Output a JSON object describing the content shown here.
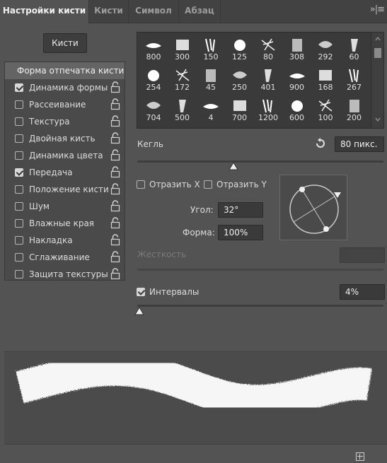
{
  "tabs": [
    {
      "label": "Настройки кисти",
      "active": true
    },
    {
      "label": "Кисти",
      "active": false
    },
    {
      "label": "Символ",
      "active": false
    },
    {
      "label": "Абзац",
      "active": false
    }
  ],
  "tab_menu_glyph": "»|≡",
  "brushes_button": "Кисти",
  "left_list": {
    "header": "Форма отпечатка кисти",
    "items": [
      {
        "label": "Динамика формы",
        "checked": true,
        "lock": true
      },
      {
        "label": "Рассеивание",
        "checked": false,
        "lock": true
      },
      {
        "label": "Текстура",
        "checked": false,
        "lock": true
      },
      {
        "label": "Двойная кисть",
        "checked": false,
        "lock": true
      },
      {
        "label": "Динамика цвета",
        "checked": false,
        "lock": true
      },
      {
        "label": "Передача",
        "checked": true,
        "lock": true
      },
      {
        "label": "Положение кисти",
        "checked": false,
        "lock": true
      },
      {
        "label": "Шум",
        "checked": false,
        "lock": true
      },
      {
        "label": "Влажные края",
        "checked": false,
        "lock": true
      },
      {
        "label": "Накладка",
        "checked": false,
        "lock": true
      },
      {
        "label": "Сглаживание",
        "checked": false,
        "lock": true
      },
      {
        "label": "Защита текстуры",
        "checked": false,
        "lock": true
      }
    ]
  },
  "brush_grid": {
    "rows": [
      [
        "800",
        "300",
        "150",
        "125",
        "80",
        "308",
        "292",
        "60"
      ],
      [
        "254",
        "172",
        "45",
        "250",
        "401",
        "900",
        "168",
        "267"
      ],
      [
        "704",
        "500",
        "4",
        "700",
        "1200",
        "600",
        "100",
        "200"
      ],
      [
        "",
        "",
        "",
        "",
        "",
        "",
        "",
        ""
      ]
    ]
  },
  "size": {
    "label": "Кегль",
    "value": "80 пикс.",
    "fraction": 0.39
  },
  "flip_x": {
    "label": "Отразить X",
    "checked": false
  },
  "flip_y": {
    "label": "Отразить Y",
    "checked": false
  },
  "angle": {
    "label": "Угол:",
    "value": "32°"
  },
  "roundness": {
    "label": "Форма:",
    "value": "100%"
  },
  "hardness": {
    "label": "Жесткость",
    "value": "",
    "disabled": true
  },
  "spacing": {
    "label": "Интервалы",
    "checked": true,
    "value": "4%",
    "fraction": 0.01
  },
  "icons": {
    "reset": "reset-icon",
    "lock": "lock-icon",
    "new": "new-brush-icon"
  }
}
